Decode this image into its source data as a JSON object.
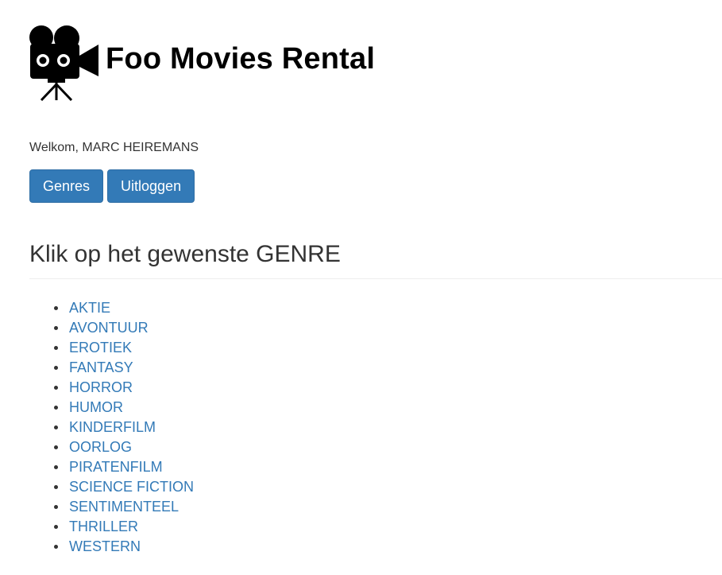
{
  "header": {
    "logo_icon": "movie-camera-icon",
    "logo_text": "Foo Movies Rental"
  },
  "welcome": {
    "text": "Welkom, MARC HEIREMANS"
  },
  "buttons": {
    "genres_label": "Genres",
    "logout_label": "Uitloggen"
  },
  "main": {
    "heading": "Klik op het gewenste GENRE",
    "genres": [
      "AKTIE",
      "AVONTUUR",
      "EROTIEK",
      "FANTASY",
      "HORROR",
      "HUMOR",
      "KINDERFILM",
      "OORLOG",
      "PIRATENFILM",
      "SCIENCE FICTION",
      "SENTIMENTEEL",
      "THRILLER",
      "WESTERN"
    ]
  },
  "colors": {
    "button_bg": "#337ab7",
    "link": "#337ab7",
    "text": "#333333"
  }
}
